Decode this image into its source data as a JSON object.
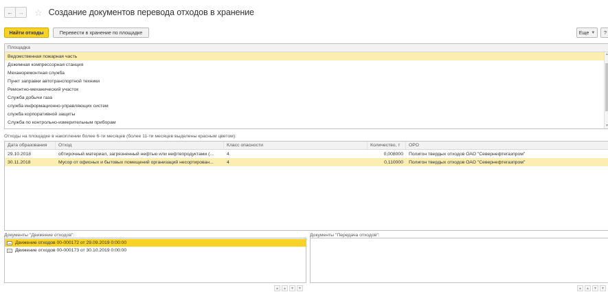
{
  "header": {
    "back_icon": "arrow-left-icon",
    "forward_icon": "arrow-right-icon",
    "favorite_icon": "star-icon",
    "title": "Создание документов перевода отходов в хранение"
  },
  "toolbar": {
    "find_label": "Найти отходы",
    "transfer_label": "Перевести в хранение по площадке",
    "more_label": "Еще",
    "help_label": "?"
  },
  "sites": {
    "column": "Площадка",
    "selected_index": 0,
    "items": [
      "Ведомственная пожарная часть",
      "Дожимная компрессорная станция",
      "Механоремонтная служба",
      "Пункт заправки автотранспортной техники",
      "Ремонтно-механический участок",
      "Служба добычи газа",
      "служба информационно-управляющих систем",
      "служба корпоративной защиты",
      "Служба по контрольно-измерительным приборам"
    ]
  },
  "waste": {
    "label": "Отходы на площадке в накоплении более 6-ти месяцев (более 11-ти месяцев выделены красным цветом):",
    "columns": {
      "date": "Дата образования",
      "waste": "Отход",
      "hazard": "Класс опасности",
      "qty": "Количество, т",
      "oro": "ОРО"
    },
    "rows": [
      {
        "date": "29.10.2018",
        "waste": "обтирочный материал, загрязненный нефтью или нефтепродуктами (...",
        "hazard": "4",
        "qty": "0,008000",
        "oro": "Полигон твердых отходов ОАО \"Севернефтегазпром\"",
        "selected": false
      },
      {
        "date": "30.11.2018",
        "waste": "Мусор от офисных и бытовых помещений организаций несортирован...",
        "hazard": "4",
        "qty": "0,110000",
        "oro": "Полигон твердых отходов ОАО \"Севернефтегазпром\"",
        "selected": true
      }
    ]
  },
  "movement_docs": {
    "label": "Документы \"Движение отходов\":",
    "items": [
      "Движение отходов 00-000172 от 29.09.2019 0:00:00",
      "Движение отходов 00-000173 от 30.10.2019 0:00:00"
    ],
    "selected_index": 0
  },
  "transfer_docs": {
    "label": "Документы \"Передача отходов\":"
  },
  "colors": {
    "accent": "#f7d328",
    "selection": "#fbeeb0"
  }
}
